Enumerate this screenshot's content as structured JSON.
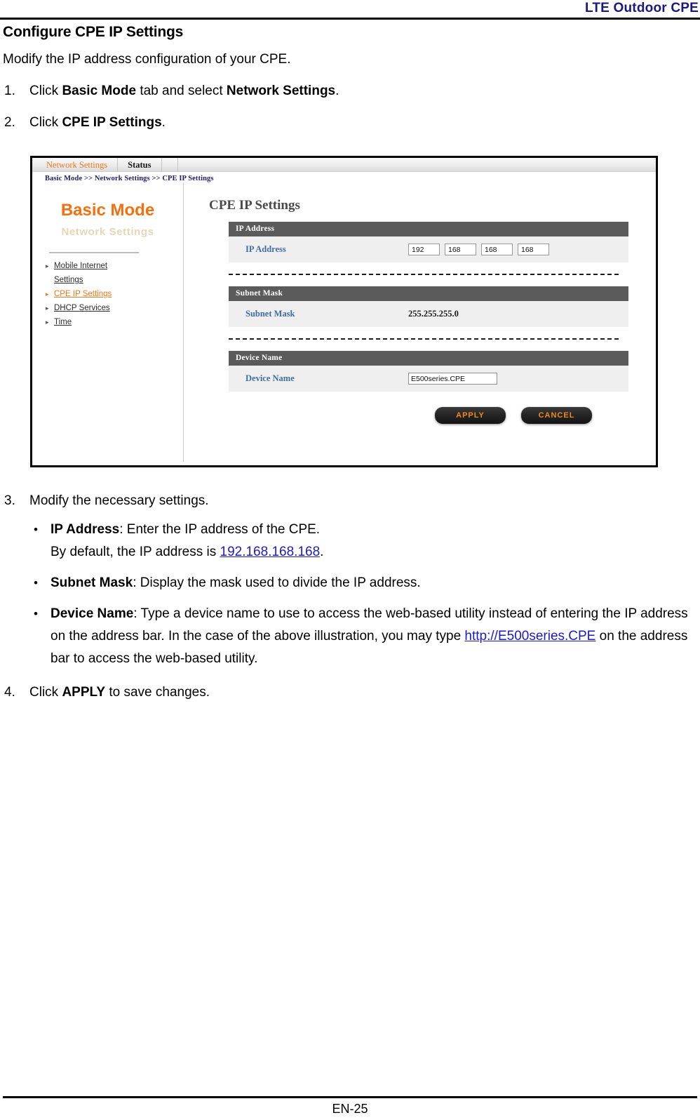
{
  "header": {
    "title": "LTE Outdoor CPE"
  },
  "document": {
    "section_title": "Configure CPE IP Settings",
    "intro": "Modify the IP address configuration of your CPE.",
    "steps": [
      {
        "num": "1.",
        "parts": [
          {
            "text": "Click ",
            "style": "normal"
          },
          {
            "text": "Basic Mode",
            "style": "bold"
          },
          {
            "text": " tab and select ",
            "style": "normal"
          },
          {
            "text": "Network Settings",
            "style": "bold"
          },
          {
            "text": ".",
            "style": "normal"
          }
        ]
      },
      {
        "num": "2.",
        "parts": [
          {
            "text": "Click ",
            "style": "normal"
          },
          {
            "text": "CPE IP Settings",
            "style": "bold"
          },
          {
            "text": ".",
            "style": "normal"
          }
        ]
      }
    ],
    "step3": {
      "num": "3.",
      "text": "Modify the necessary settings."
    },
    "bullets": [
      {
        "dot": "•",
        "term": "IP Address",
        "colon": ": ",
        "body_before": "Enter the IP address of the CPE.",
        "body_line2_before": "By default, the IP address is ",
        "link": "192.168.168.168",
        "body_after": "."
      },
      {
        "dot": "•",
        "term": "Subnet Mask",
        "colon": ": ",
        "body": "Display the mask used to divide the IP address."
      },
      {
        "dot": "•",
        "term": "Device Name",
        "colon": ": ",
        "body_before": "Type a device name to use to access the web-based utility instead of entering the IP address on the address bar. In the case of the above illustration, you may type ",
        "link": "http://E500series.CPE",
        "body_after": " on the address bar to access the web-based utility."
      }
    ],
    "step4": {
      "num": "4.",
      "before": "Click ",
      "bold": "APPLY",
      "after": " to save changes."
    }
  },
  "figure": {
    "tabs": [
      {
        "label": "Network Settings",
        "state": "active"
      },
      {
        "label": "Status",
        "state": "inactive"
      }
    ],
    "breadcrumb": "Basic Mode >> Network Settings >> CPE IP Settings",
    "sidebar": {
      "brand": "Basic Mode",
      "brand_sub": "Network Settings",
      "menu": [
        {
          "label": "Mobile Internet",
          "label_line2": "Settings",
          "state": "normal",
          "bullet": "▸"
        },
        {
          "label": "CPE IP Settings",
          "state": "active",
          "bullet": "▸"
        },
        {
          "label": "DHCP Services",
          "state": "normal",
          "bullet": "▸"
        },
        {
          "label": "Time",
          "state": "normal",
          "bullet": "▸"
        }
      ]
    },
    "main": {
      "title": "CPE IP Settings",
      "panels": [
        {
          "head": "IP Address",
          "label": "IP Address",
          "type": "ip",
          "octets": [
            "192",
            "168",
            "168",
            "168"
          ]
        },
        {
          "head": "Subnet Mask",
          "label": "Subnet Mask",
          "type": "text",
          "value": "255.255.255.0"
        },
        {
          "head": "Device Name",
          "label": "Device Name",
          "type": "input",
          "value": "E500series.CPE"
        }
      ],
      "buttons": [
        {
          "label": "APPLY",
          "name": "apply-button"
        },
        {
          "label": "CANCEL",
          "name": "cancel-button"
        }
      ]
    }
  },
  "footer": {
    "page": "EN-25"
  },
  "colors": {
    "header_blue": "#1a1a7e",
    "brand_orange": "#f4700f",
    "panel_head_gray": "#5b5b5b",
    "panel_row_gray": "#efefef",
    "label_blue": "#3e6ea6",
    "link_blue": "#1b1bc4",
    "button_text_orange": "#f08a1c"
  }
}
